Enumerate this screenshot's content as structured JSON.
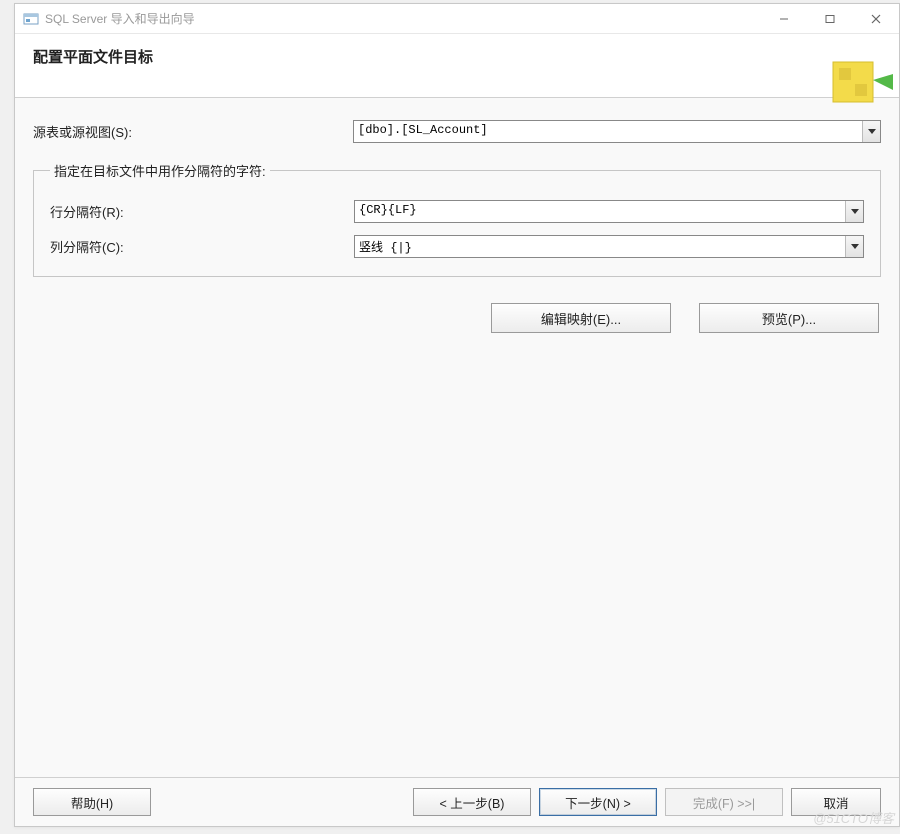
{
  "window": {
    "title": "SQL Server 导入和导出向导"
  },
  "header": {
    "title": "配置平面文件目标"
  },
  "source": {
    "label": "源表或源视图(S):",
    "value": "[dbo].[SL_Account]"
  },
  "delimiter_group": {
    "legend": "指定在目标文件中用作分隔符的字符:",
    "row_delim": {
      "label": "行分隔符(R):",
      "value": "{CR}{LF}"
    },
    "col_delim": {
      "label": "列分隔符(C):",
      "value": "竖线 {|}"
    }
  },
  "actions": {
    "edit_mapping": "编辑映射(E)...",
    "preview": "预览(P)..."
  },
  "footer": {
    "help": "帮助(H)",
    "back": "< 上一步(B)",
    "next": "下一步(N) >",
    "finish": "完成(F) >>|",
    "cancel": "取消"
  },
  "watermark": "@51CTO博客"
}
